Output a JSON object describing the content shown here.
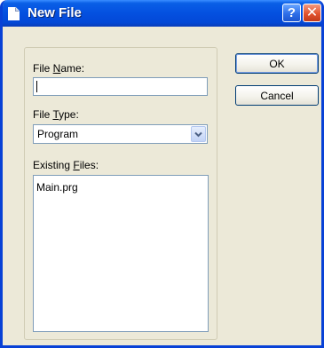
{
  "window": {
    "title": "New File",
    "icon": "document-icon",
    "help_glyph": "?",
    "close_glyph": "✕"
  },
  "form": {
    "file_name": {
      "label_prefix": "File ",
      "label_mnemonic": "N",
      "label_suffix": "ame:",
      "value": ""
    },
    "file_type": {
      "label_prefix": "File ",
      "label_mnemonic": "T",
      "label_suffix": "ype:",
      "selected": "Program"
    },
    "existing_files": {
      "label_prefix": "Existing ",
      "label_mnemonic": "F",
      "label_suffix": "iles:",
      "items": [
        "Main.prg"
      ]
    }
  },
  "buttons": {
    "ok": "OK",
    "cancel": "Cancel"
  }
}
